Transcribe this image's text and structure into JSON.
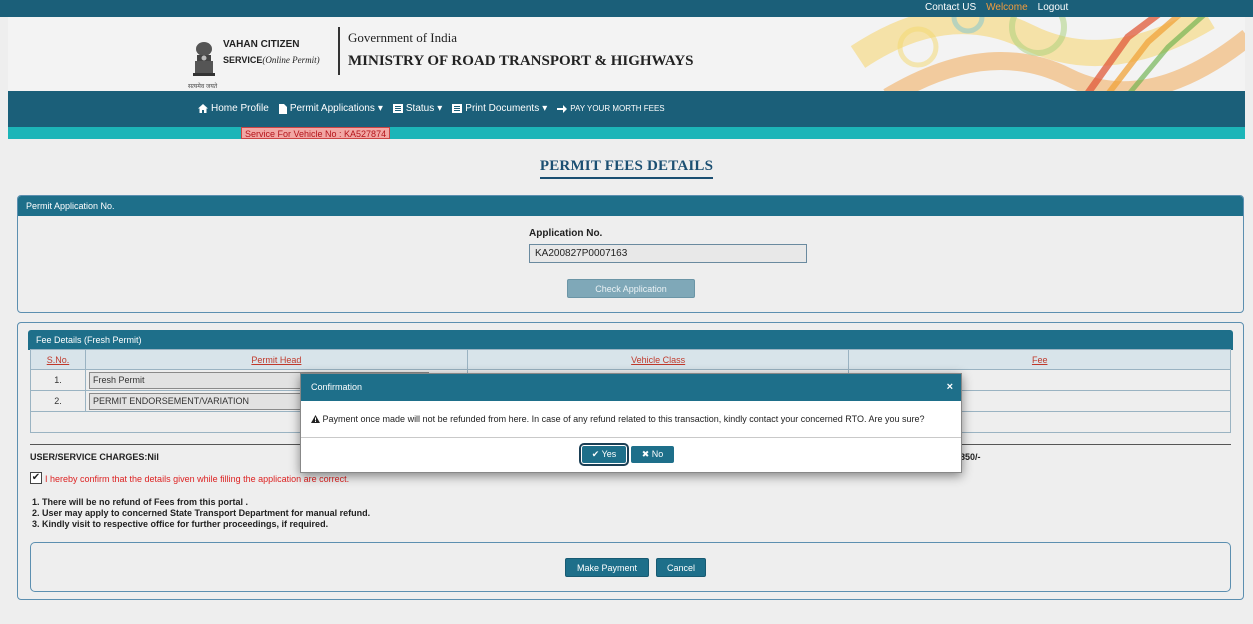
{
  "header": {
    "top_links": {
      "contact": "Contact US",
      "welcome": "Welcome",
      "logout": "Logout"
    },
    "vahan_line1": "VAHAN CITIZEN",
    "vahan_line2": "SERVICE",
    "vahan_line2_italic": "(Online Permit)",
    "emblem_caption": "सत्यमेव जयते",
    "gov": "Government of India",
    "ministry": "MINISTRY OF ROAD TRANSPORT & HIGHWAYS"
  },
  "nav": {
    "home": "Home Profile",
    "permit": "Permit Applications",
    "status": "Status",
    "print": "Print Documents",
    "pay": "PAY YOUR MORTH FEES"
  },
  "vehicle_service": "Service For Vehicle No : KA527874",
  "page_title": "PERMIT FEES DETAILS",
  "application_panel": {
    "heading": "Permit Application No.",
    "label": "Application No.",
    "value": "KA200827P0007163",
    "check_button": "Check Application"
  },
  "fee_panel": {
    "heading": "Fee Details (Fresh Permit)",
    "columns": [
      "S.No.",
      "Permit Head",
      "Vehicle Class",
      "Fee"
    ],
    "rows": [
      {
        "sno": "1.",
        "head": "Fresh Permit"
      },
      {
        "sno": "2.",
        "head": "PERMIT ENDORSEMENT/VARIATION"
      }
    ],
    "user_charges": "USER/SERVICE CHARGES:Nil",
    "total_fee": "s. 850/-",
    "confirm_text": "I hereby confirm that the details given while filling the application are correct.",
    "notes": [
      "1. There will be no refund of Fees from this portal .",
      "2. User may apply to concerned State Transport Department for manual refund.",
      "3. Kindly visit to respective office for further proceedings, if required."
    ],
    "make_payment": "Make Payment",
    "cancel": "Cancel"
  },
  "modal": {
    "title": "Confirmation",
    "close": "×",
    "message": "Payment once made will not be refunded from here. In case of any refund related to this transaction, kindly contact your concerned RTO. Are you sure?",
    "yes": "Yes",
    "no": "No"
  },
  "colors": {
    "primary": "#1e6f8a",
    "navbar": "#1b5f79",
    "teal_strip": "#1cb5b8",
    "alert_red": "#b3151b"
  }
}
